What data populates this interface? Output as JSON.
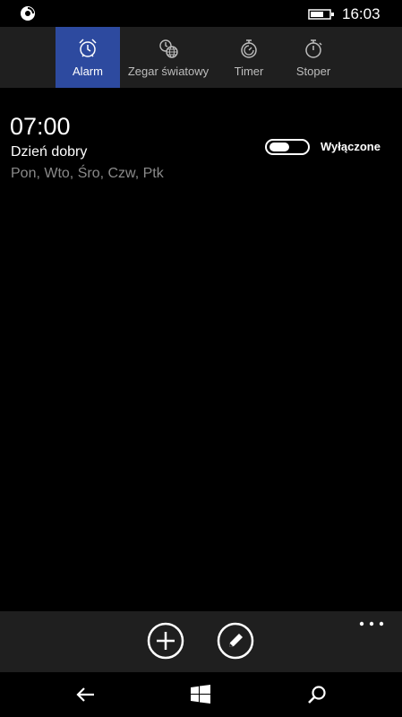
{
  "status_bar": {
    "app_icon": "notification-app-icon",
    "battery_icon": "battery-icon",
    "time": "16:03"
  },
  "tabs": [
    {
      "label": "Alarm",
      "icon": "alarm-clock-icon",
      "active": true
    },
    {
      "label": "Zegar światowy",
      "icon": "world-clock-icon",
      "active": false
    },
    {
      "label": "Timer",
      "icon": "timer-icon",
      "active": false
    },
    {
      "label": "Stoper",
      "icon": "stopwatch-icon",
      "active": false
    }
  ],
  "alarm": {
    "time": "07:00",
    "name": "Dzień dobry",
    "days": "Pon, Wto, Śro, Czw, Ptk",
    "toggle_state": "off",
    "toggle_label": "Wyłączone"
  },
  "app_bar": {
    "buttons": [
      {
        "icon": "add-icon"
      },
      {
        "icon": "edit-icon"
      }
    ],
    "more_icon": "more-ellipsis-icon"
  },
  "nav_bar": {
    "back_icon": "back-arrow-icon",
    "start_icon": "windows-logo-icon",
    "search_icon": "search-icon"
  },
  "colors": {
    "accent": "#2d4a9f",
    "background": "#000000",
    "bar_background": "#1f1f1f",
    "secondary_text": "#8a8a8a"
  }
}
